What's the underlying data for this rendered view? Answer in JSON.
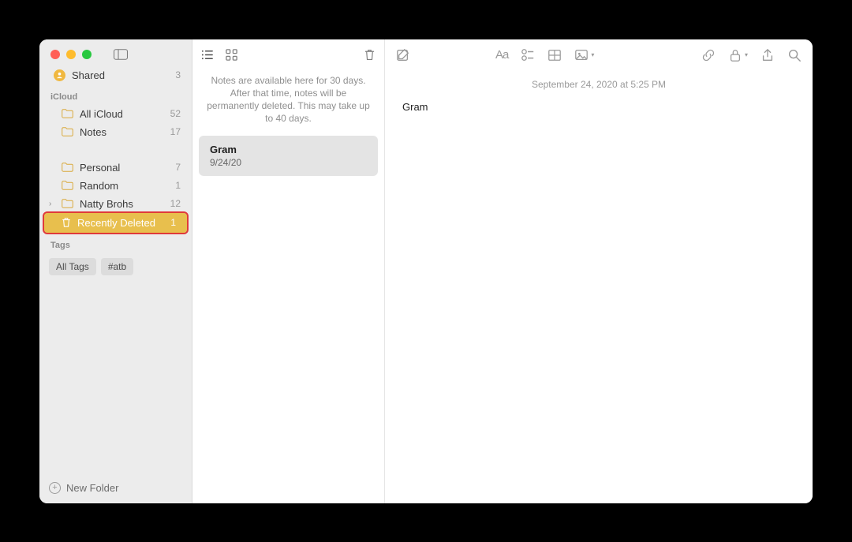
{
  "sidebar": {
    "shared": {
      "label": "Shared",
      "count": "3"
    },
    "section_icloud": "iCloud",
    "items": [
      {
        "label": "All iCloud",
        "count": "52"
      },
      {
        "label": "Notes",
        "count": "17"
      },
      {
        "label": "Personal",
        "count": "7"
      },
      {
        "label": "Random",
        "count": "1"
      },
      {
        "label": "Natty Brohs",
        "count": "12"
      },
      {
        "label": "Recently Deleted",
        "count": "1"
      }
    ],
    "section_tags": "Tags",
    "tags": [
      {
        "label": "All Tags"
      },
      {
        "label": "#atb"
      }
    ],
    "new_folder": "New Folder"
  },
  "notes_list": {
    "info": "Notes are available here for 30 days. After that time, notes will be permanently deleted. This may take up to 40 days.",
    "notes": [
      {
        "title": "Gram",
        "date": "9/24/20"
      }
    ]
  },
  "editor": {
    "timestamp": "September 24, 2020 at 5:25 PM",
    "body": "Gram"
  }
}
